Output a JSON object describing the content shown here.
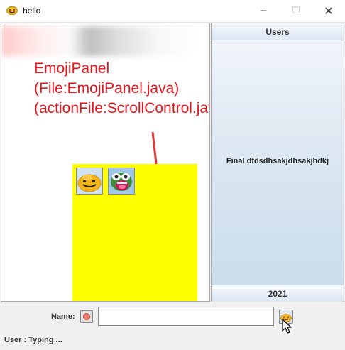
{
  "window": {
    "title": "hello",
    "minimize_glyph": "─",
    "maximize_glyph": "☐",
    "close_glyph": "✕"
  },
  "annotation": {
    "line1": "EmojiPanel",
    "line2": "(File:EmojiPanel.java)",
    "line3": "(actionFile:ScrollControl.java)",
    "color": "#e8141c"
  },
  "emoji_panel": {
    "background": "#ffff00",
    "items": [
      {
        "icon": "smiley-emoji-icon"
      },
      {
        "icon": "pepe-frog-emoji-icon"
      }
    ]
  },
  "users_panel": {
    "header": "Users",
    "user_entry": "Final dfdsdhsakjdhsakjhdkj",
    "footer": "2021"
  },
  "input_bar": {
    "name_label": "Name:",
    "name_value": "",
    "status_icon": "red-dot-icon",
    "emoji_button_icon": "smiley-emoji-icon"
  },
  "status": {
    "text": "User : Typing ..."
  }
}
